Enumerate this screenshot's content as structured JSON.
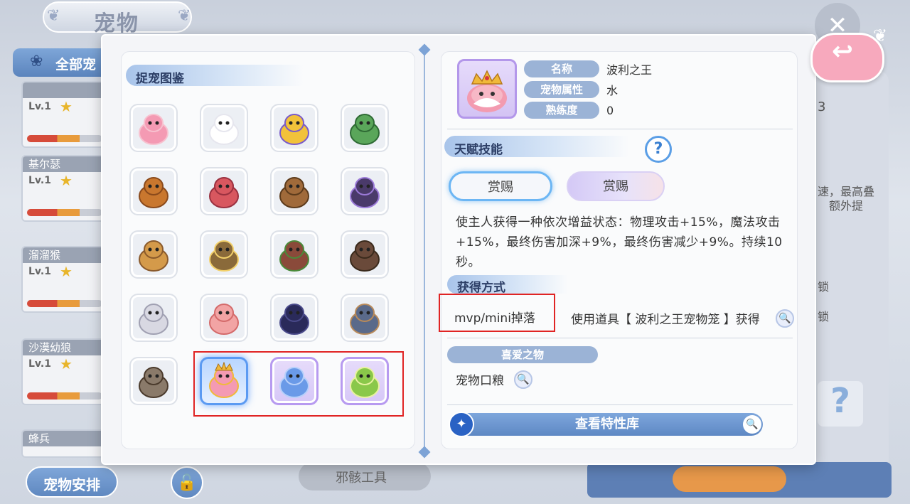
{
  "background": {
    "title": "宠物",
    "all_tab": "全部宠",
    "cards": [
      {
        "name": "",
        "level": "Lv.1"
      },
      {
        "name": "基尔瑟",
        "level": "Lv.1"
      },
      {
        "name": "溜溜猴",
        "level": "Lv.1"
      },
      {
        "name": "沙漠幼狼",
        "level": "Lv.1"
      },
      {
        "name": "蜂兵",
        "level": ""
      }
    ],
    "right_text_1": "速，最高叠",
    "right_text_2": "额外提",
    "right_lock_1": "锁",
    "right_lock_2": "锁",
    "right_num": "3",
    "bottom_button": "宠物安排",
    "skill_bar": "邪骸工具"
  },
  "left_panel": {
    "section_title": "捉宠图鉴",
    "pets": [
      {
        "id": "poring",
        "state": "normal"
      },
      {
        "id": "lunatic-rabbit",
        "state": "normal"
      },
      {
        "id": "hornet",
        "state": "normal"
      },
      {
        "id": "mantis",
        "state": "normal"
      },
      {
        "id": "lion-cub",
        "state": "normal"
      },
      {
        "id": "yoyo-monkey",
        "state": "normal"
      },
      {
        "id": "goggle-warrior",
        "state": "normal"
      },
      {
        "id": "fly-bug",
        "state": "normal"
      },
      {
        "id": "peco-bird",
        "state": "normal"
      },
      {
        "id": "snail",
        "state": "normal"
      },
      {
        "id": "tree-ent",
        "state": "normal"
      },
      {
        "id": "hedgehog",
        "state": "normal"
      },
      {
        "id": "white-rat",
        "state": "normal"
      },
      {
        "id": "smokie-pig",
        "state": "normal"
      },
      {
        "id": "ninja",
        "state": "normal"
      },
      {
        "id": "archer",
        "state": "normal"
      },
      {
        "id": "raccoon",
        "state": "normal"
      },
      {
        "id": "king-poring",
        "state": "selected"
      },
      {
        "id": "blue-fluff",
        "state": "purple"
      },
      {
        "id": "green-bee",
        "state": "purple"
      }
    ]
  },
  "detail": {
    "labels": {
      "name": "名称",
      "attribute": "宠物属性",
      "proficiency": "熟练度"
    },
    "name": "波利之王",
    "attribute": "水",
    "proficiency": "0",
    "talent_title": "天赋技能",
    "help": "?",
    "skill_tab_1": "赏赐",
    "skill_tab_2": "赏赐",
    "description": "使主人获得一种依次增益状态：物理攻击+15%，魔法攻击+15%，最终伤害加深+9%，最终伤害减少+9%。持续10秒。",
    "obtain_title": "获得方式",
    "obtain_method_1": "mvp/mini掉落",
    "obtain_method_2": "使用道具【 波利之王宠物笼 】获得",
    "fav_title": "喜爱之物",
    "fav_item": "宠物口粮",
    "library_button": "查看特性库"
  },
  "colors": {
    "accent": "#5e88c4",
    "highlight_red": "#e02424",
    "selected_glow": "#5b9af2",
    "purple_rarity": "#b79af0"
  }
}
